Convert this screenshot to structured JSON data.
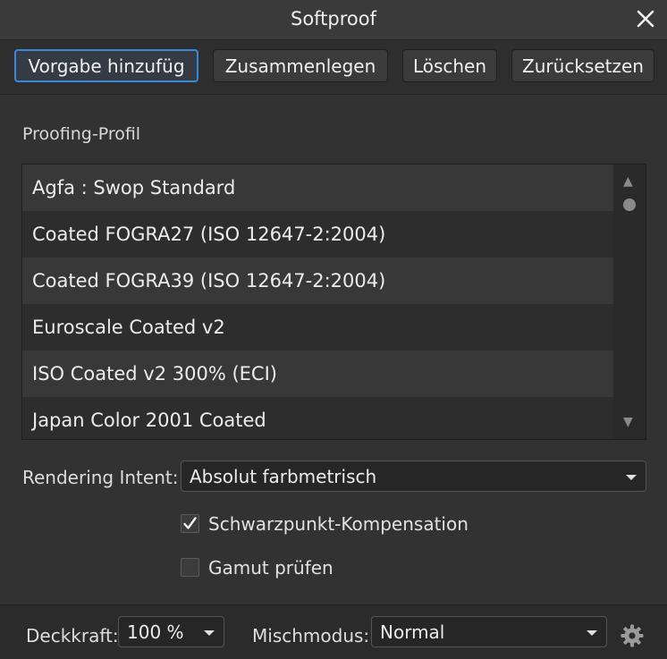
{
  "window": {
    "title": "Softproof",
    "close_icon": "close-icon"
  },
  "toolbar": {
    "add_preset_label": "Vorgabe hinzufüg",
    "merge_label": "Zusammenlegen",
    "delete_label": "Löschen",
    "reset_label": "Zurücksetzen"
  },
  "profile": {
    "label": "Proofing-Profil",
    "items": [
      "Agfa : Swop Standard",
      "Coated FOGRA27 (ISO 12647-2:2004)",
      "Coated FOGRA39 (ISO 12647-2:2004)",
      "Euroscale Coated v2",
      "ISO Coated v2 300% (ECI)",
      "Japan Color 2001 Coated"
    ],
    "scroll_up_glyph": "▲",
    "scroll_down_glyph": "▼",
    "scroll_position": 0.0
  },
  "rendering": {
    "label": "Rendering Intent:",
    "value": "Absolut farbmetrisch"
  },
  "options": {
    "black_point_label": "Schwarzpunkt-Kompensation",
    "black_point_checked": true,
    "gamut_label": "Gamut prüfen",
    "gamut_checked": false
  },
  "footer": {
    "opacity_label": "Deckkraft:",
    "opacity_value": "100 %",
    "blend_label": "Mischmodus:",
    "blend_value": "Normal",
    "settings_icon": "gear-icon"
  },
  "colors": {
    "accent": "#3a87d8",
    "panel": "#323232"
  }
}
